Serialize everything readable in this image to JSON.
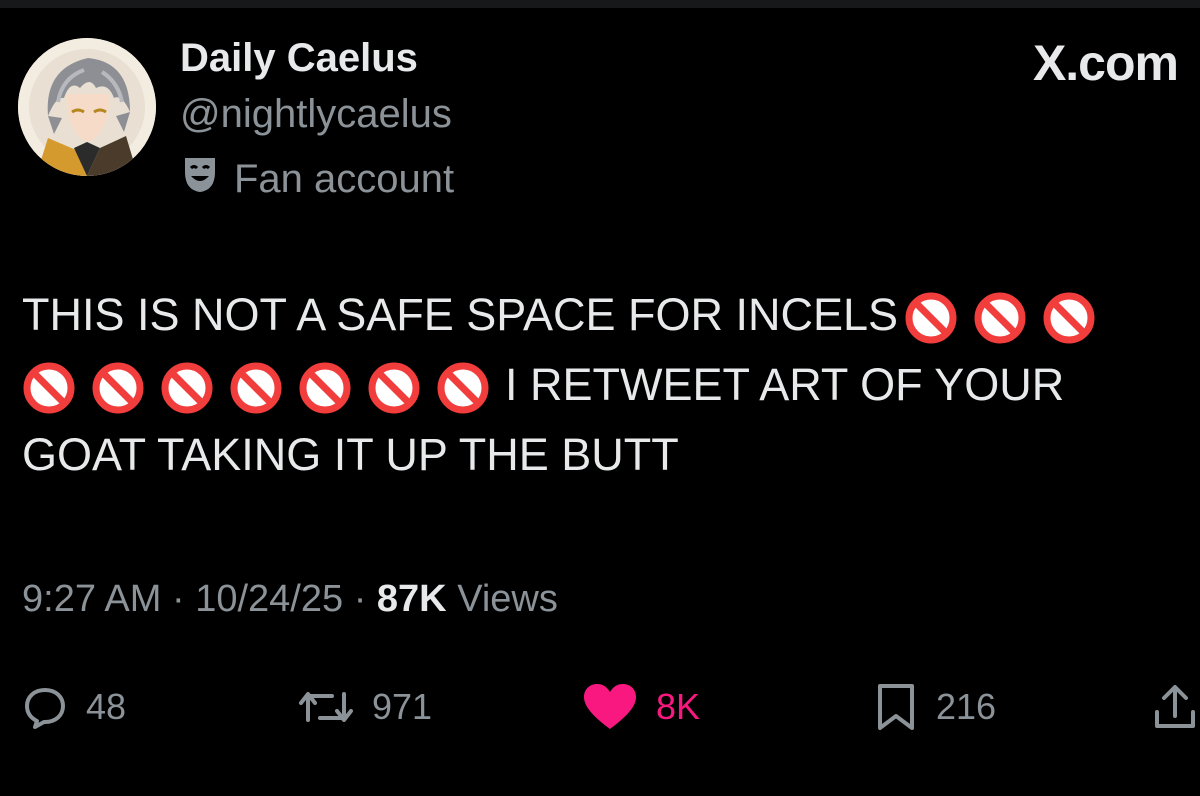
{
  "header": {
    "display_name": "Daily Caelus",
    "handle": "@nightlycaelus",
    "account_label": "Fan account",
    "account_label_icon": "theater-masks-icon",
    "brand": "X.com"
  },
  "tweet": {
    "lines": [
      {
        "text": "THIS IS NOT A SAFE SPACE FOR INCELS",
        "emoji_after": 3
      },
      {
        "emoji_before": 7,
        "text": "I RETWEET ART OF YOUR"
      },
      {
        "text": "GOAT TAKING IT UP THE BUTT"
      }
    ],
    "emoji": "🚫"
  },
  "meta": {
    "time": "9:27 AM",
    "date": "10/24/25",
    "views_count": "87K",
    "views_label": "Views",
    "separator": "·"
  },
  "actions": {
    "replies": "48",
    "retweets": "971",
    "likes": "8K",
    "bookmarks": "216",
    "like_color": "#f91880",
    "icon_color": "#8b9298"
  }
}
